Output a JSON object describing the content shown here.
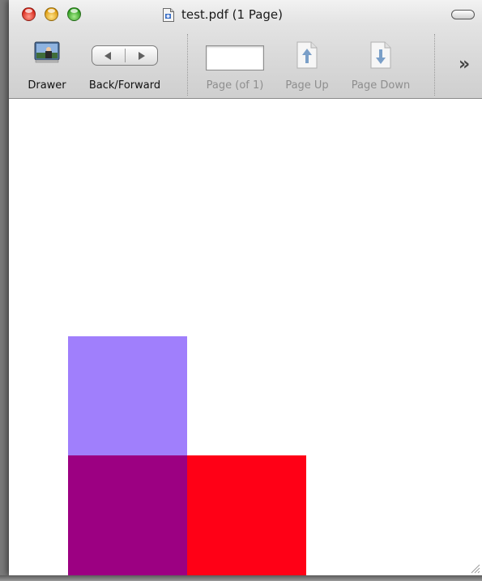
{
  "window": {
    "title": "test.pdf (1 Page)",
    "document_icon": "pdf-document-icon"
  },
  "toolbar": {
    "drawer_label": "Drawer",
    "back_forward_label": "Back/Forward",
    "page_field_value": "",
    "page_field_label": "Page (of 1)",
    "page_up_label": "Page Up",
    "page_down_label": "Page Down",
    "overflow_symbol": "»"
  },
  "document": {
    "shapes": [
      {
        "name": "purple-light-square",
        "color": "#a07ffc"
      },
      {
        "name": "purple-dark-square",
        "color": "#9c0082"
      },
      {
        "name": "red-square",
        "color": "#ff0016"
      }
    ]
  }
}
